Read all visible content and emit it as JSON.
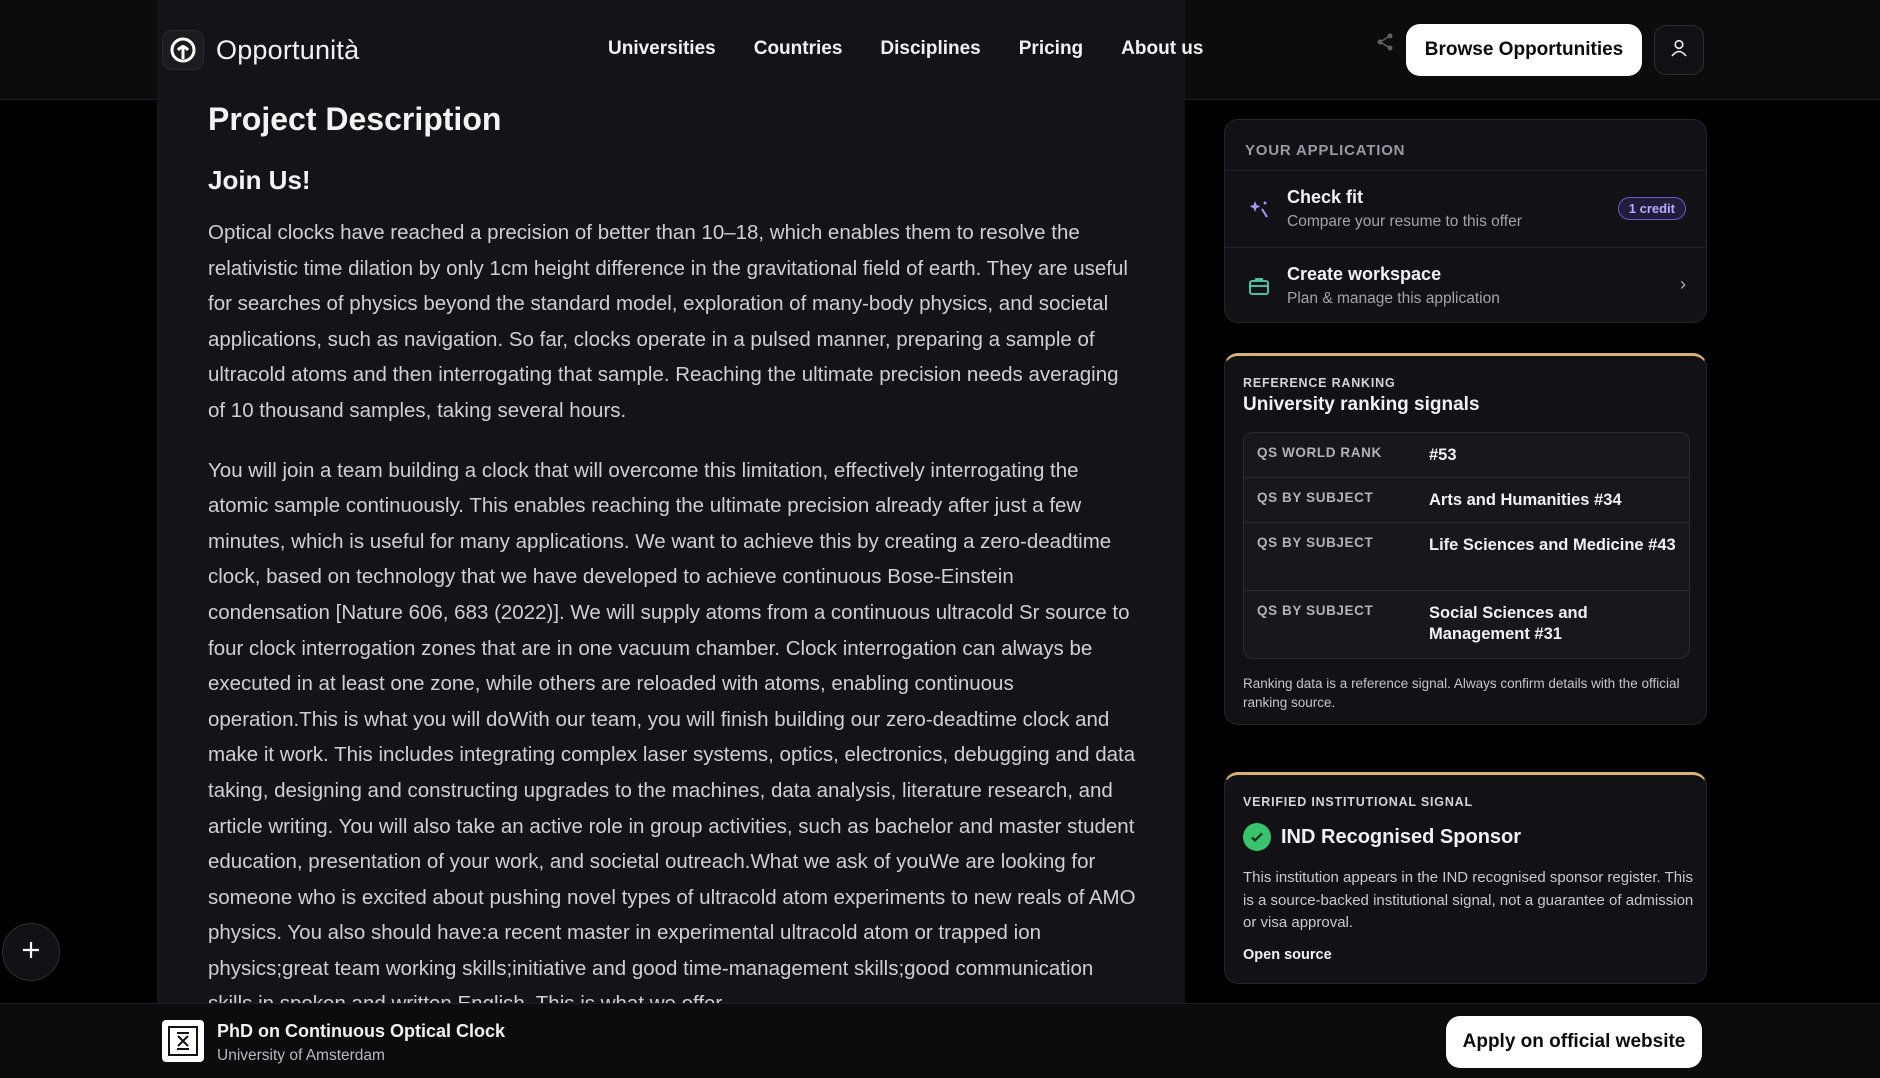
{
  "header": {
    "brand": "Opportunità",
    "nav": [
      "Universities",
      "Countries",
      "Disciplines",
      "Pricing",
      "About us"
    ],
    "browse_label": "Browse Opportunities",
    "icons": {
      "brand": "opportunita-logo-icon",
      "share": "share-icon",
      "profile": "user-icon"
    }
  },
  "main": {
    "title": "Project Description",
    "subtitle": "Join Us!",
    "paragraphs": [
      "Optical clocks have reached a precision of better than 10–18, which enables them to resolve the relativistic time dilation by only 1cm height difference in the gravitational field of earth. They are useful for searches of physics beyond the standard model, exploration of many-body physics, and societal applications, such as navigation. So far, clocks operate in a pulsed manner, preparing a sample of ultracold atoms and then interrogating that sample. Reaching the ultimate precision needs averaging of 10 thousand samples, taking several hours.",
      "You will join a team building a clock that will overcome this limitation, effectively interrogating the atomic sample continuously. This enables reaching the ultimate precision already after just a few minutes, which is useful for many applications. We want to achieve this by creating a zero-deadtime clock, based on technology that we have developed to achieve continuous Bose-Einstein condensation [Nature 606, 683 (2022)]. We will supply atoms from a continuous ultracold Sr source to four clock interrogation zones that are in one vacuum chamber. Clock interrogation can always be executed in at least one zone, while others are reloaded with atoms, enabling continuous operation.This is what you will doWith our team, you will finish building our zero-deadtime clock and make it work. This includes integrating complex laser systems, optics, electronics, debugging and data taking, designing and constructing upgrades to the machines, data analysis, literature research, and article writing. You will also take an active role in group activities, such as bachelor and master student education, presentation of your work, and societal outreach.What we ask of youWe are looking for someone who is excited about pushing novel types of ultracold atom experiments to new reals of AMO physics. You also should have:a recent master in experimental ultracold atom or trapped ion physics;great team working skills;initiative and good time-management skills;good communication skills in spoken and written English. This is what we offer"
    ]
  },
  "application": {
    "heading": "YOUR APPLICATION",
    "check_fit": {
      "title": "Check fit",
      "subtitle": "Compare your resume to this offer",
      "badge": "1 credit",
      "icon": "sparkle-icon"
    },
    "workspace": {
      "title": "Create workspace",
      "subtitle": "Plan & manage this application",
      "icon": "briefcase-icon",
      "chevron": "›"
    }
  },
  "ranking": {
    "label": "REFERENCE RANKING",
    "title": "University ranking signals",
    "rows": [
      {
        "key": "QS WORLD RANK",
        "value": "#53"
      },
      {
        "key": "QS BY SUBJECT",
        "value": "Arts and Humanities #34"
      },
      {
        "key": "QS BY SUBJECT",
        "value": "Life Sciences and Medicine #43"
      },
      {
        "key": "QS BY SUBJECT",
        "value": "Social Sciences and Management #31"
      }
    ],
    "note": "Ranking data is a reference signal. Always confirm details with the official ranking source."
  },
  "ind": {
    "label": "VERIFIED INSTITUTIONAL SIGNAL",
    "title": "IND Recognised Sponsor",
    "description": "This institution appears in the IND recognised sponsor register. This is a source-backed institutional signal, not a guarantee of admission or visa approval.",
    "link": "Open source",
    "icon": "check-circle-icon",
    "accent": "#38c46e"
  },
  "fab": {
    "icon": "plus-icon"
  },
  "bottom": {
    "position_title": "PhD on Continuous Optical Clock",
    "university": "University of Amsterdam",
    "apply_label": "Apply on official website",
    "logo_icon": "university-logo-icon"
  },
  "colors": {
    "background": "#000000",
    "panel": "#141418",
    "accent_gold": "#d6b273",
    "badge_purple": "#b9a8ff"
  }
}
